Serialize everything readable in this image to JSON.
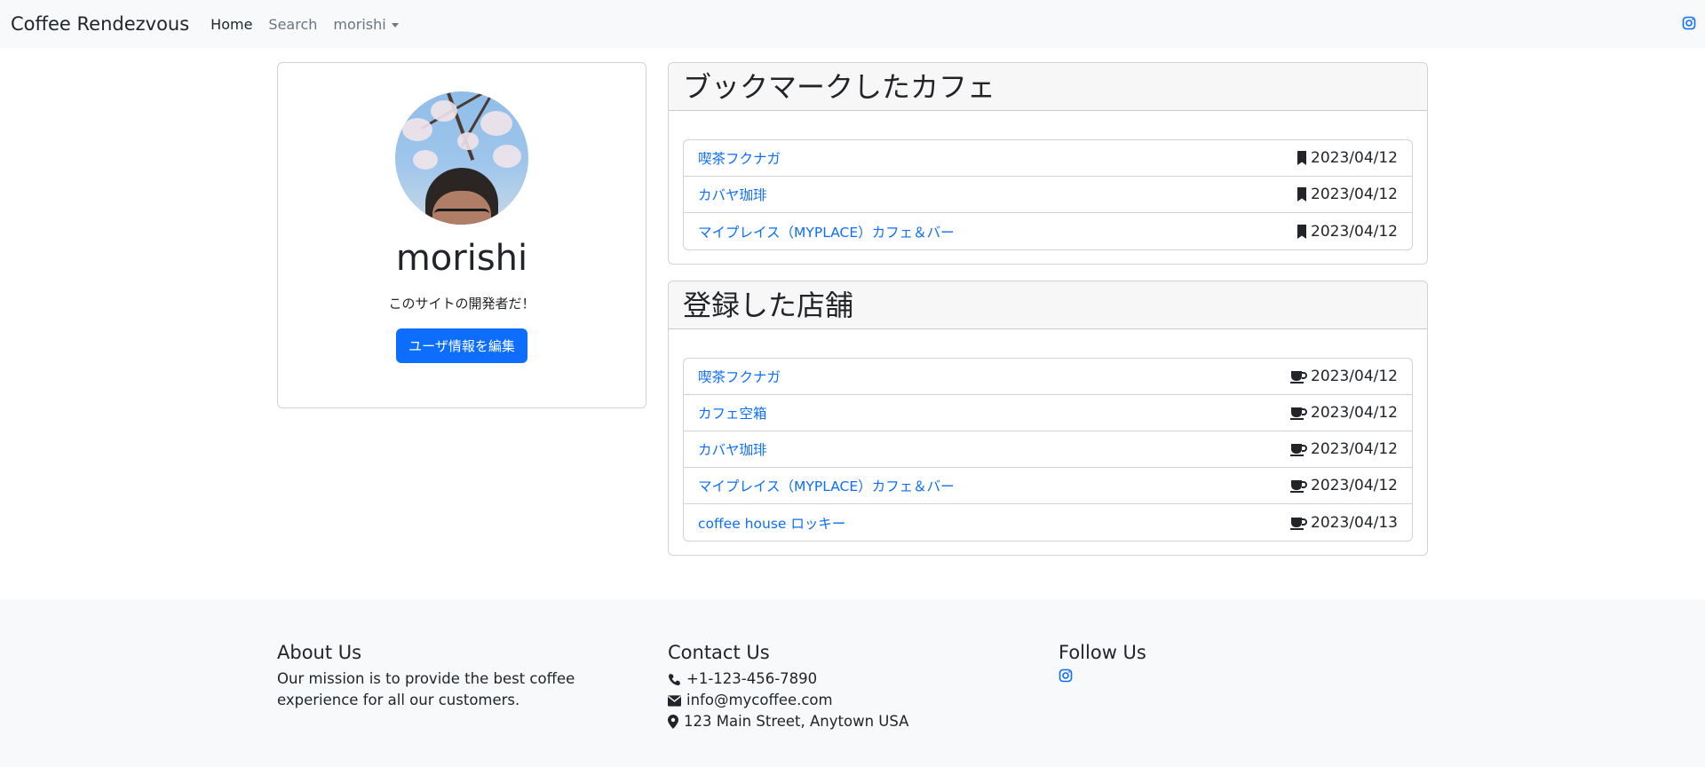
{
  "navbar": {
    "brand": "Coffee Rendezvous",
    "links": [
      "Home",
      "Search"
    ],
    "user_menu": "morishi",
    "right_icon": "instagram-icon"
  },
  "profile": {
    "name": "morishi",
    "bio": "このサイトの開発者だ！",
    "edit_button": "ユーザ情報を編集"
  },
  "bookmarks": {
    "title": "ブックマークしたカフェ",
    "icon": "bookmark-icon",
    "items": [
      {
        "name": "喫茶フクナガ",
        "date": "2023/04/12"
      },
      {
        "name": "カバヤ珈琲",
        "date": "2023/04/12"
      },
      {
        "name": "マイプレイス（MYPLACE）カフェ＆バー",
        "date": "2023/04/12"
      }
    ]
  },
  "registered": {
    "title": "登録した店舗",
    "icon": "coffee-cup-icon",
    "items": [
      {
        "name": "喫茶フクナガ",
        "date": "2023/04/12"
      },
      {
        "name": "カフェ空箱",
        "date": "2023/04/12"
      },
      {
        "name": "カバヤ珈琲",
        "date": "2023/04/12"
      },
      {
        "name": "マイプレイス（MYPLACE）カフェ＆バー",
        "date": "2023/04/12"
      },
      {
        "name": "coffee house ロッキー",
        "date": "2023/04/13"
      }
    ]
  },
  "footer": {
    "about_title": "About Us",
    "about_text": "Our mission is to provide the best coffee experience for all our customers.",
    "contact_title": "Contact Us",
    "phone": "+1-123-456-7890",
    "email": "info@mycoffee.com",
    "address": "123 Main Street, Anytown USA",
    "follow_title": "Follow Us"
  },
  "colors": {
    "link": "#0d6efd",
    "primary_button": "#0d6efd",
    "navbar_bg": "#f8f9fa",
    "footer_bg": "#f8f9fa"
  }
}
